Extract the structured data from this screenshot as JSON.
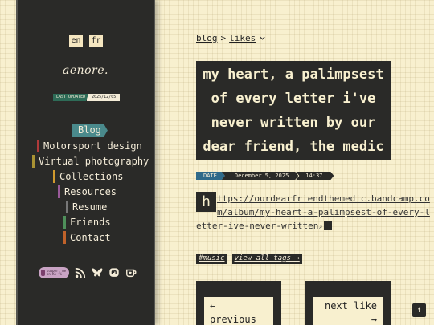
{
  "sidebar": {
    "languages": [
      "en",
      "fr"
    ],
    "logo": "aenore.",
    "last_updated_label": "LAST UPDATED",
    "last_updated_value": "2025/12/05",
    "active_item": "Blog",
    "items": [
      {
        "label": "Motorsport design",
        "color": "#b03a3a"
      },
      {
        "label": "Virtual photography",
        "color": "#a99233"
      },
      {
        "label": "Collections",
        "color": "#d09a2e"
      },
      {
        "label": "Resources",
        "color": "#9a5a9a"
      },
      {
        "label": "Resume",
        "color": "#777777"
      },
      {
        "label": "Friends",
        "color": "#4e8f5a"
      },
      {
        "label": "Contact",
        "color": "#c0622a"
      }
    ],
    "kofi_label": "support me on Ko-fi",
    "social_icons": [
      "rss-icon",
      "bluesky-icon",
      "mastodon-icon",
      "kofi-cup-icon"
    ]
  },
  "breadcrumb": {
    "root": "blog",
    "separator": ">",
    "current": "likes"
  },
  "post": {
    "title": "my heart, a palimpsest of every letter i've never written by our dear friend, the medic",
    "date_label": "DATE",
    "date": "December 5, 2025",
    "time": "14:37",
    "dropcap": "h",
    "link": "ttps://ourdearfriendthemedic.bandcamp.com/album/my-heart-a-palimpsest-of-every-letter-ive-never-written",
    "tags": [
      "#music",
      "view all tags →"
    ]
  },
  "pager": {
    "prev": "← previous",
    "next": "next like →"
  },
  "to_top": "↑",
  "colors": {
    "accent_teal": "#4a8a8c",
    "date_blue": "#2f6a8a",
    "panel": "#2a2a28",
    "paper": "#f8f0cf"
  }
}
